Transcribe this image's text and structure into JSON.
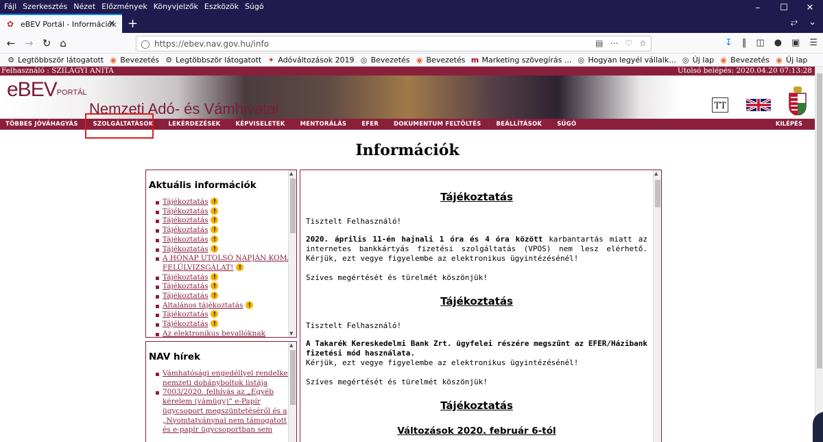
{
  "browser": {
    "menu": [
      "Fájl",
      "Szerkesztés",
      "Nézet",
      "Előzmények",
      "Könyvjelzők",
      "Eszközök",
      "Súgó"
    ],
    "tab_title": "eBEV Portál - Információk",
    "url_host": "https://ebev.nav.gov.hu",
    "url_path": "/info",
    "bookmarks": [
      {
        "label": "Legtöbbször látogatott",
        "icon": "gear-icon"
      },
      {
        "label": "Bevezetés",
        "icon": "firefox-icon"
      },
      {
        "label": "Legtöbbször látogatott",
        "icon": "gear-icon"
      },
      {
        "label": "Adóváltozások 2019",
        "icon": "tax-icon"
      },
      {
        "label": "Bevezetés",
        "icon": "globe-icon"
      },
      {
        "label": "Bevezetés",
        "icon": "firefox-icon"
      },
      {
        "label": "Marketing szövegírás ...",
        "icon": "m-icon"
      },
      {
        "label": "Hogyan legyél vállalk...",
        "icon": "globe-icon"
      },
      {
        "label": "Új lap",
        "icon": "globe-icon"
      },
      {
        "label": "Bevezetés",
        "icon": "firefox-icon"
      },
      {
        "label": "Új lap",
        "icon": "firefox-icon"
      }
    ]
  },
  "userbar": {
    "user": "Felhasználó : SZILÁGYI ANITA",
    "last_login": "Utolsó belépés: 2020.04.20 07:13:28"
  },
  "banner": {
    "logo_main": "eBEV",
    "logo_small": "PORTÁL",
    "title": "Nemzeti Adó- és Vámhivatal",
    "font_btn": "TT"
  },
  "nav": {
    "items": [
      "TÖBBES JÓVÁHAGYÁS",
      "SZOLGÁLTATÁSOK",
      "LEKÉRDEZÉSEK",
      "KÉPVISELETEK",
      "MENTORÁLÁS",
      "EFER",
      "DOKUMENTUM FELTÖLTÉS",
      "BEÁLLÍTÁSOK",
      "SÚGÓ"
    ],
    "exit": "KILÉPÉS"
  },
  "page_title": "Információk",
  "aktualis": {
    "title": "Aktuális információk",
    "items": [
      {
        "text": "Tájékoztatás",
        "warn": true
      },
      {
        "text": "Tájékoztatás",
        "warn": true
      },
      {
        "text": "Tájékoztatás",
        "warn": true
      },
      {
        "text": "Tájékoztatás",
        "warn": true
      },
      {
        "text": "Tájékoztatás",
        "warn": true
      },
      {
        "text": "Tájékoztatás",
        "warn": true
      },
      {
        "text": "A HÓNAP UTOLSÓ NAPJÁN KOMA FELÜLVIZSGÁLAT!",
        "warn": true
      },
      {
        "text": "Tájékoztatás",
        "warn": true
      },
      {
        "text": "Tájékoztatás",
        "warn": true
      },
      {
        "text": "Tájékoztatás",
        "warn": true
      },
      {
        "text": "Általános tájékoztatás",
        "warn": true
      },
      {
        "text": "Tájékoztatás",
        "warn": true
      },
      {
        "text": "Tájékoztatás",
        "warn": true
      },
      {
        "text": "Az elektronikus bevallóknak",
        "warn": false
      }
    ]
  },
  "nav_hirek": {
    "title": "NAV hírek",
    "items": [
      "Vámhatósági engedéllyel rendelkező nemzeti dohányboltok listája",
      "7003/2020. felhívás az „Egyéb kérelem (vámügy)” e-Papír ügycsoport megszüntetéséről és a „Nyomtatványnal nem támogatott és e-papír ügycsoportban sem"
    ]
  },
  "content": {
    "h1": "Tájékoztatás",
    "greeting1": "Tisztelt Felhasználó!",
    "p1_bold": "2020. április 11-én hajnali 1 óra és 4 óra között",
    "p1_rest": " karbantartás miatt az internetes bankkártyás fizetési szolgáltatás (VPOS) nem lesz elérhető. Kérjük, ezt vegye figyelembe az elektronikus ügyintézésénél!",
    "thanks1": "Szíves megértését és türelmét köszönjük!",
    "h2": "Tájékoztatás",
    "greeting2": "Tisztelt Felhasználó!",
    "p2_bold": "A Takarék Kereskedelmi Bank Zrt. ügyfelei részére megszűnt az EFER/Házibank fizetési mód használata.",
    "p2_rest": "Kérjük, ezt vegye figyelembe az elektronikus ügyintézésénél!",
    "thanks2": "Szíves megértését és türelmét köszönjük!",
    "h3": "Tájékoztatás",
    "h4": "Változások 2020. február 6-tól"
  }
}
